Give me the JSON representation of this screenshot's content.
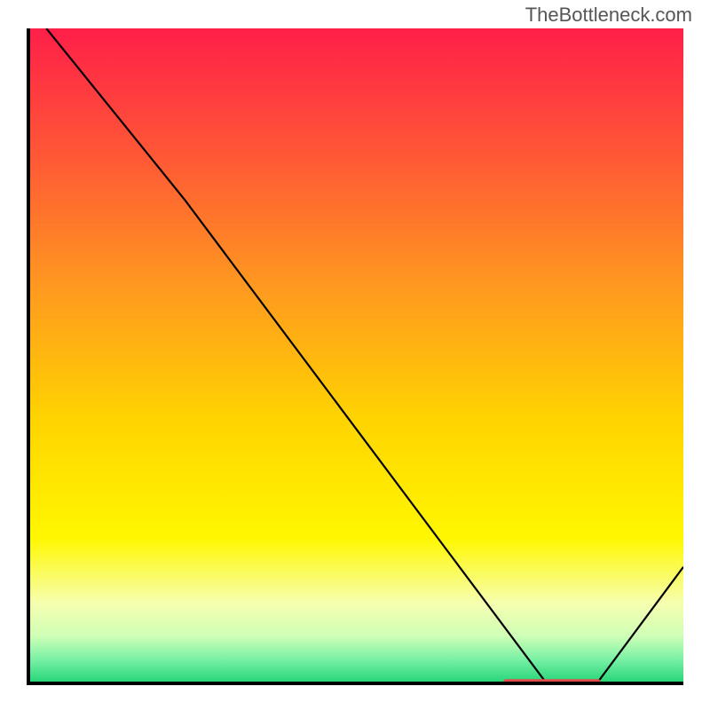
{
  "attribution": "TheBottleneck.com",
  "chart_data": {
    "type": "line",
    "title": "",
    "xlabel": "",
    "ylabel": "",
    "xlim": [
      0,
      100
    ],
    "ylim": [
      0,
      100
    ],
    "grid": false,
    "legend": false,
    "series": [
      {
        "name": "curve",
        "color": "#000000",
        "x": [
          3,
          24,
          79,
          87,
          100
        ],
        "y": [
          100,
          74,
          0.5,
          0.5,
          18
        ]
      },
      {
        "name": "marker-band",
        "color": "#e44a4a",
        "x": [
          73,
          87
        ],
        "y": [
          0.5,
          0.5
        ]
      }
    ],
    "background_gradient": {
      "stops": [
        {
          "offset": 0.0,
          "color": "#ff1f49"
        },
        {
          "offset": 0.2,
          "color": "#ff5935"
        },
        {
          "offset": 0.4,
          "color": "#ff9a1f"
        },
        {
          "offset": 0.6,
          "color": "#ffd400"
        },
        {
          "offset": 0.78,
          "color": "#fff700"
        },
        {
          "offset": 0.88,
          "color": "#f6ffb0"
        },
        {
          "offset": 0.93,
          "color": "#cfffb6"
        },
        {
          "offset": 0.965,
          "color": "#7cf1a6"
        },
        {
          "offset": 1.0,
          "color": "#28d67a"
        }
      ]
    }
  }
}
